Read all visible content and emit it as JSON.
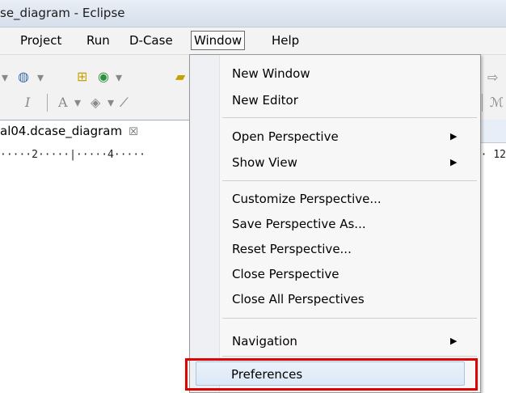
{
  "window": {
    "title": "se_diagram - Eclipse"
  },
  "menubar": {
    "items": [
      {
        "label": "Project"
      },
      {
        "label": "Run"
      },
      {
        "label": "D-Case"
      },
      {
        "label": "Window"
      },
      {
        "label": "Help"
      }
    ]
  },
  "editor": {
    "tab_label": "al04.dcase_diagram",
    "ruler_left": "·····2·····|·····4·····",
    "ruler_right": "·· 12"
  },
  "window_menu": {
    "items": [
      {
        "label": "New Window"
      },
      {
        "label": "New Editor"
      },
      {
        "label": "Open Perspective"
      },
      {
        "label": "Show View"
      },
      {
        "label": "Customize Perspective..."
      },
      {
        "label": "Save Perspective As..."
      },
      {
        "label": "Reset Perspective..."
      },
      {
        "label": "Close Perspective"
      },
      {
        "label": "Close All Perspectives"
      },
      {
        "label": "Navigation"
      },
      {
        "label": "Preferences"
      }
    ]
  },
  "colors": {
    "highlight_box": "#e00000",
    "selection_bg": "#dbe8f6"
  }
}
